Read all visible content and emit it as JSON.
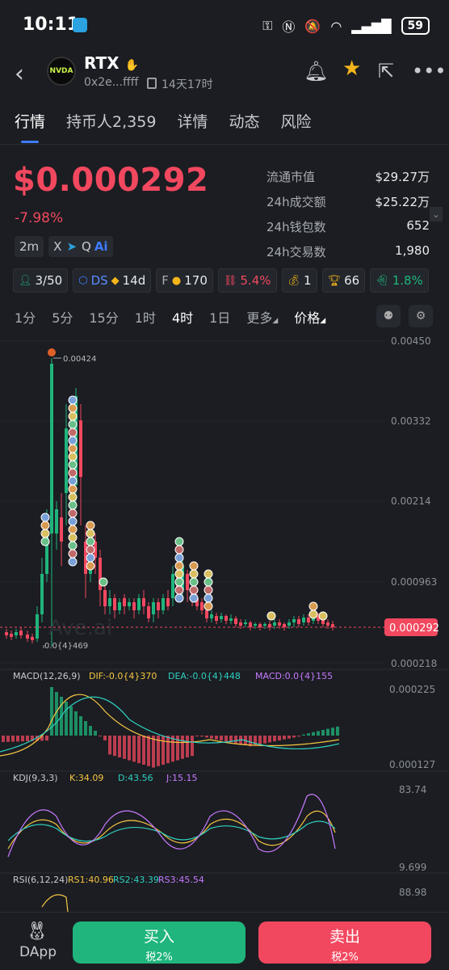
{
  "status_bar": {
    "time": "10:11",
    "battery": "59",
    "icons": [
      "key-icon",
      "nfc-icon",
      "mute-icon",
      "wifi-icon",
      "signal-icon"
    ]
  },
  "token": {
    "name": "RTX",
    "avatar_text": "NVDA",
    "address": "0x2e...ffff",
    "age": "14天17时"
  },
  "tabs": [
    "行情",
    "持币人2,359",
    "详情",
    "动态",
    "风险"
  ],
  "price": {
    "value": "$0.000292",
    "change": "-7.98%"
  },
  "stats": [
    {
      "label": "流通市值",
      "value": "$29.27万"
    },
    {
      "label": "24h成交额",
      "value": "$25.22万"
    },
    {
      "label": "24h钱包数",
      "value": "652"
    },
    {
      "label": "24h交易数",
      "value": "1,980"
    }
  ],
  "mini_chips": [
    "2m",
    "X",
    "➤",
    "Q",
    "Ai"
  ],
  "metrics": [
    {
      "icon": "user-icon",
      "value": "3/50"
    },
    {
      "icon": "ds-icon",
      "label": "DS",
      "value": "14d"
    },
    {
      "icon": "f-icon",
      "label": "F",
      "value": "170"
    },
    {
      "icon": "chain-icon",
      "value": "5.4%"
    },
    {
      "icon": "money-bag-icon",
      "value": "1"
    },
    {
      "icon": "trophy-icon",
      "value": "66"
    },
    {
      "icon": "ghost-icon",
      "value": "1.8%"
    }
  ],
  "timeframes": [
    "1分",
    "5分",
    "15分",
    "1时",
    "4时",
    "1日",
    "更多",
    "价格"
  ],
  "selected_timeframe": "4时",
  "chart": {
    "price_axis": [
      "0.00450",
      "0.00332",
      "0.00214",
      "0.000963",
      "0.000218"
    ],
    "current_price": "0.000292",
    "high_label": "0.00424",
    "low_label": "0.0{4}469",
    "watermark": "Ave.ai",
    "macd": {
      "title": "MACD(12,26,9)",
      "dif": "DIF:-0.0{4}370",
      "dea": "DEA:-0.0{4}448",
      "macd": "MACD:0.0{4}155",
      "axis_top": "0.000225",
      "axis_bottom": "0.000127"
    },
    "kdj": {
      "title": "KDJ(9,3,3)",
      "k": "K:34.09",
      "d": "D:43.56",
      "j": "J:15.15",
      "axis_top": "83.74",
      "axis_bottom": "9.699"
    },
    "rsi": {
      "title": "RSI(6,12,24)",
      "rs1": "RS1:40.96",
      "rs2": "RS2:43.39",
      "rs3": "RS3:45.54",
      "axis_top": "88.98"
    },
    "colors": {
      "up": "#1fb57c",
      "down": "#f2485f",
      "bg": "#1b1d22"
    }
  },
  "bottom": {
    "dapp": "DApp",
    "buy": "买入",
    "buy_tax": "税2%",
    "sell": "卖出",
    "sell_tax": "税2%"
  }
}
